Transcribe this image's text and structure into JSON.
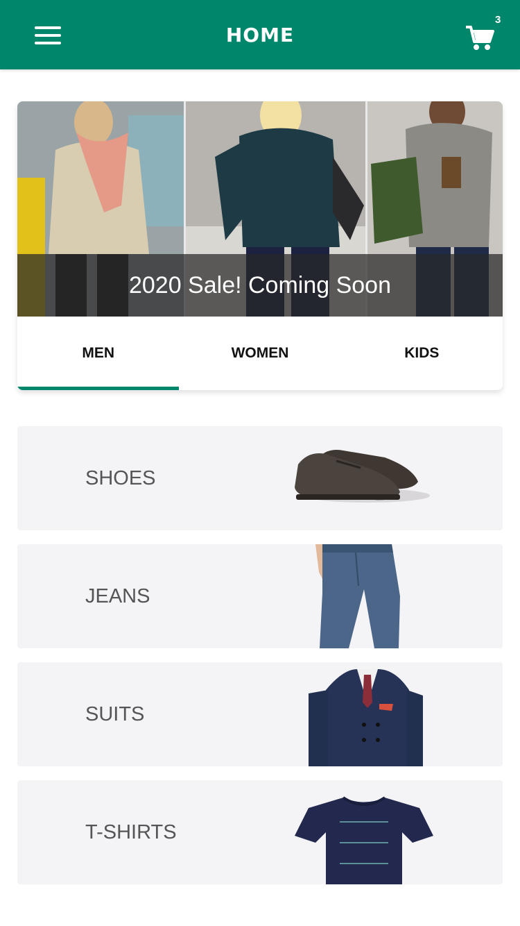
{
  "app_bar": {
    "title": "HOME",
    "cart_count": "3"
  },
  "banner": {
    "caption": "2020 Sale! Coming Soon"
  },
  "tabs": [
    {
      "label": "MEN",
      "active": true
    },
    {
      "label": "WOMEN",
      "active": false
    },
    {
      "label": "KIDS",
      "active": false
    }
  ],
  "categories": [
    {
      "label": "SHOES",
      "image": "shoes-image"
    },
    {
      "label": "JEANS",
      "image": "jeans-image"
    },
    {
      "label": "SUITS",
      "image": "suit-image"
    },
    {
      "label": "T-SHIRTS",
      "image": "tshirt-image"
    }
  ],
  "colors": {
    "primary": "#00876b",
    "category_bg": "#f4f3f6"
  }
}
